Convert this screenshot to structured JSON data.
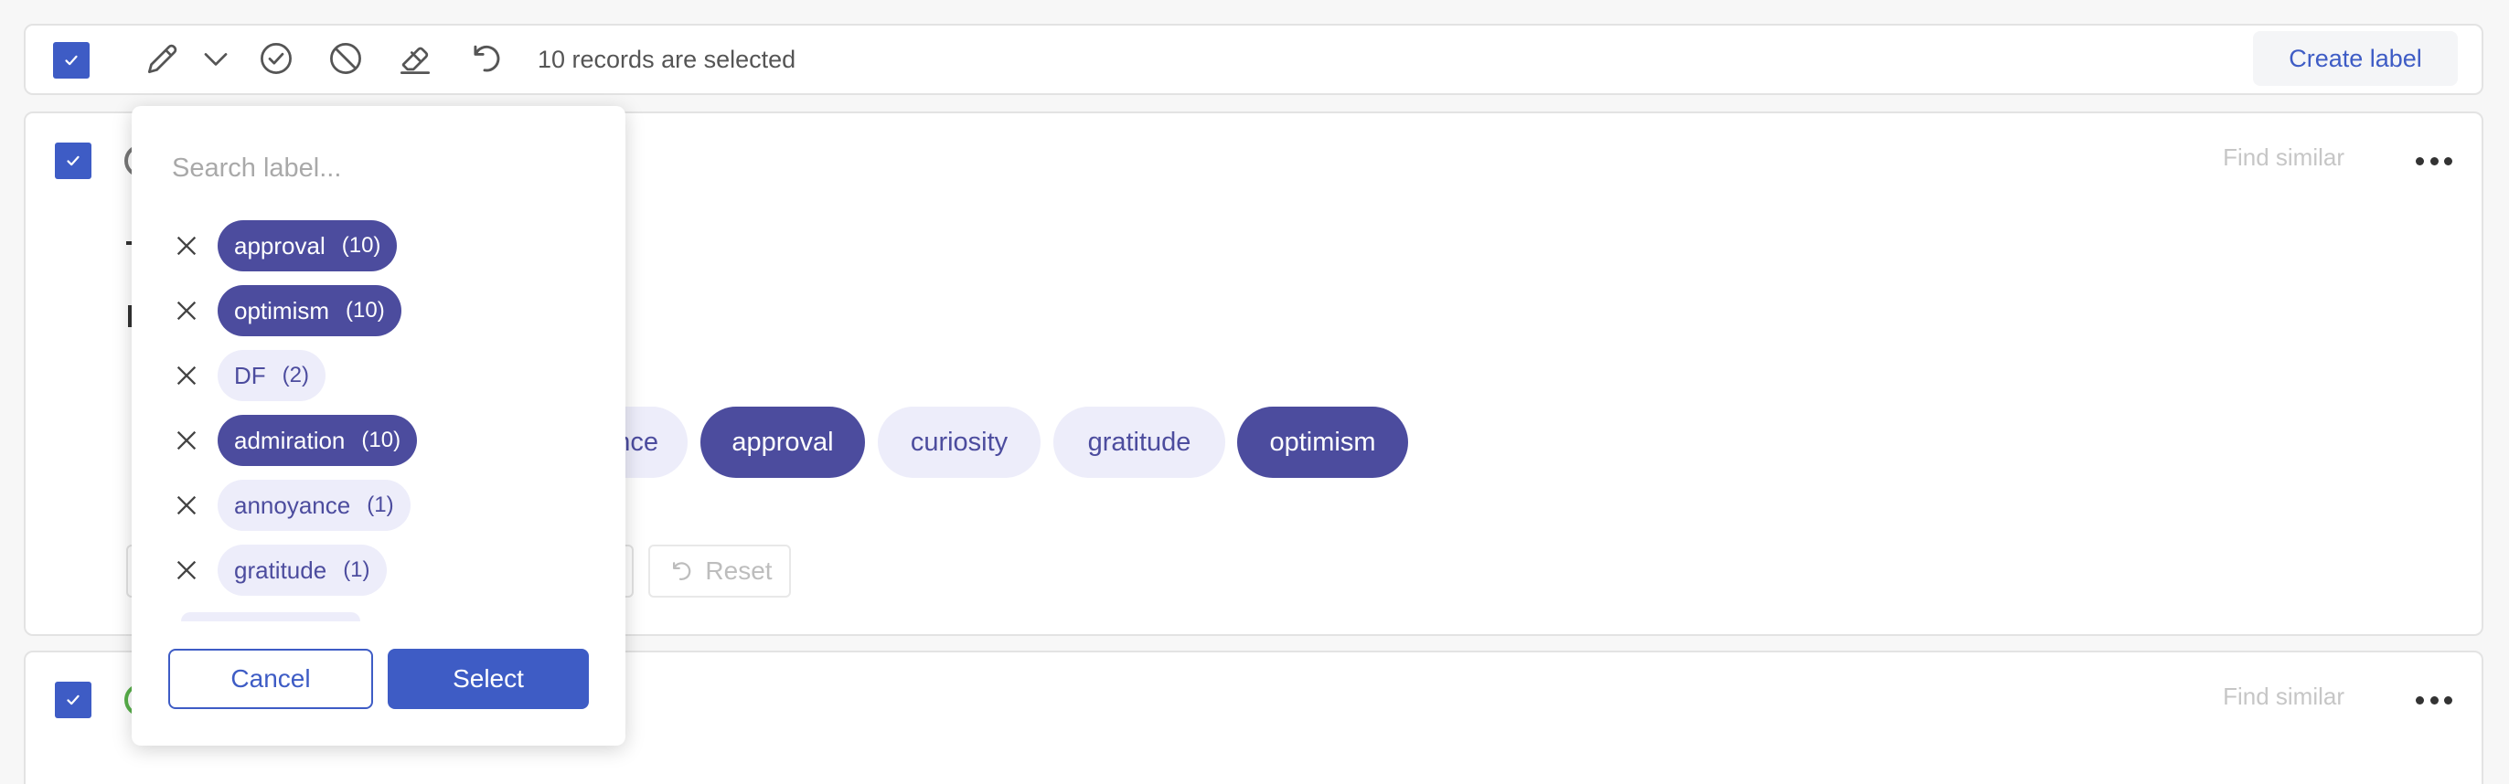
{
  "toolbar": {
    "records_selected_text": "10 records are selected",
    "create_label": "Create label"
  },
  "record_actions": {
    "find_similar": "Find similar"
  },
  "record_1": {
    "visible_chips": [
      {
        "label": "ance",
        "selected": false
      },
      {
        "label": "approval",
        "selected": true
      },
      {
        "label": "curiosity",
        "selected": false
      },
      {
        "label": "gratitude",
        "selected": false
      },
      {
        "label": "optimism",
        "selected": true
      }
    ],
    "reset_label": "Reset"
  },
  "label_dropdown": {
    "search_placeholder": "Search label...",
    "labels": [
      {
        "name": "approval",
        "count": "(10)",
        "style": "dark"
      },
      {
        "name": "optimism",
        "count": "(10)",
        "style": "dark"
      },
      {
        "name": "DF",
        "count": "(2)",
        "style": "soft"
      },
      {
        "name": "admiration",
        "count": "(10)",
        "style": "dark"
      },
      {
        "name": "annoyance",
        "count": "(1)",
        "style": "soft"
      },
      {
        "name": "gratitude",
        "count": "(1)",
        "style": "soft"
      }
    ],
    "cancel_label": "Cancel",
    "select_label": "Select"
  },
  "colors": {
    "accent": "#3e5cc5",
    "chip_selected": "#4c4c9e",
    "chip_light": "#ededfa"
  }
}
